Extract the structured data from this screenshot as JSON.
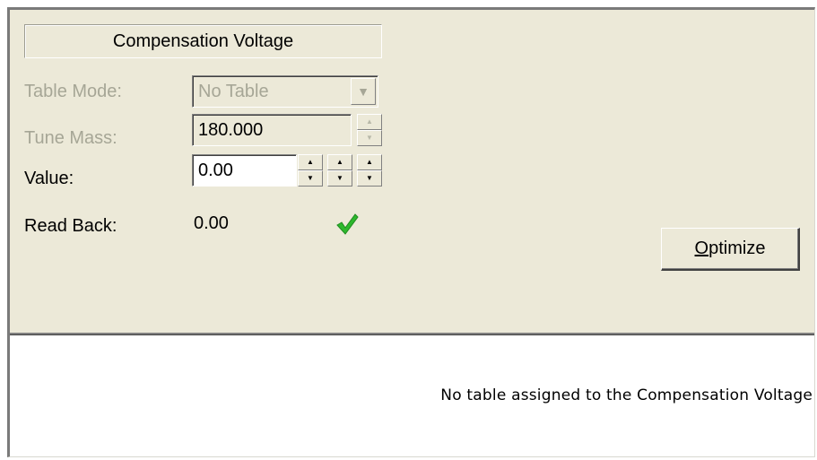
{
  "section": {
    "title": "Compensation Voltage"
  },
  "table_mode": {
    "label": "Table Mode:",
    "value": "No Table",
    "enabled": false
  },
  "tune_mass": {
    "label": "Tune Mass:",
    "value": "180.000",
    "enabled": false
  },
  "value_field": {
    "label": "Value:",
    "value": "0.00"
  },
  "read_back": {
    "label": "Read Back:",
    "value": "0.00",
    "status_icon": "green-checkmark-icon",
    "status_color": "#2db82d"
  },
  "optimize_button": {
    "mnemonic": "O",
    "rest": "ptimize"
  },
  "table_panel": {
    "message": "No table assigned to the Compensation Voltage"
  },
  "colors": {
    "window_bg": "#ece9d8",
    "disabled_text": "#a6a696",
    "table_bg": "#ffffff"
  }
}
